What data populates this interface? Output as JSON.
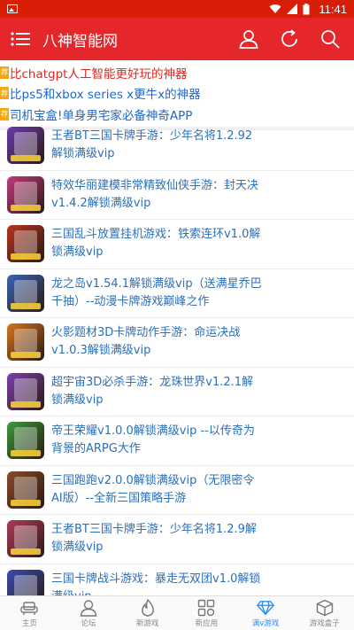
{
  "status_bar": {
    "time": "11:41"
  },
  "app_bar": {
    "title": "八神智能网"
  },
  "notices": [
    {
      "tag": "荐",
      "text": "比chatgpt人工智能更好玩的神器",
      "color": "red"
    },
    {
      "tag": "荐",
      "text": "比ps5和xbox series x更牛x的神器",
      "color": "blue"
    },
    {
      "tag": "荐",
      "text": "司机宝盒!单身男宅家必备神奇APP",
      "color": "blue"
    }
  ],
  "items": [
    {
      "title": "王者BT三国卡牌手游：少年名将1.2.92解锁满级vip",
      "thumb_color": "#6a3bb0"
    },
    {
      "title": "特效华丽建模非常精致仙侠手游：封天决v1.4.2解锁满级vip",
      "thumb_color": "#c23a7d"
    },
    {
      "title": "三国乱斗放置挂机游戏：铁索连环v1.0解锁满级vip",
      "thumb_color": "#b8331f"
    },
    {
      "title": "龙之岛v1.54.1解锁满级vip（送满星乔巴千抽）--动漫卡牌游戏巅峰之作",
      "thumb_color": "#3a63b6"
    },
    {
      "title": "火影题材3D卡牌动作手游：命运决战v1.0.3解锁满级vip",
      "thumb_color": "#d9761c"
    },
    {
      "title": "超宇宙3D必杀手游：龙珠世界v1.2.1解锁满级vip",
      "thumb_color": "#7d3fb0"
    },
    {
      "title": "帝王荣耀v1.0.0解锁满级vip --以传奇为背景的ARPG大作",
      "thumb_color": "#3d9a3a"
    },
    {
      "title": "三国跑跑v2.0.0解锁满级vip（无限密令AI版）--全新三国策略手游",
      "thumb_color": "#8a4a2a"
    },
    {
      "title": "王者BT三国卡牌手游：少年名将1.2.9解锁满级vip",
      "thumb_color": "#b03a5a"
    },
    {
      "title": "三国卡牌战斗游戏：暴走无双团v1.0解锁满级vip",
      "thumb_color": "#3a4bb0"
    }
  ],
  "tabs": [
    {
      "label": "主页",
      "icon": "sofa-icon",
      "active": false
    },
    {
      "label": "论坛",
      "icon": "user-icon",
      "active": false
    },
    {
      "label": "新游戏",
      "icon": "flame-icon",
      "active": false
    },
    {
      "label": "新应用",
      "icon": "grid-icon",
      "active": false
    },
    {
      "label": "满v游戏",
      "icon": "diamond-icon",
      "active": true
    },
    {
      "label": "游戏盒子",
      "icon": "box-icon",
      "active": false
    }
  ],
  "colors": {
    "status_bar": "#d81e06",
    "app_bar": "#e5262a",
    "link_blue": "#2b6fb8",
    "notice_red": "#e0261f",
    "tab_active": "#1a8cff"
  }
}
